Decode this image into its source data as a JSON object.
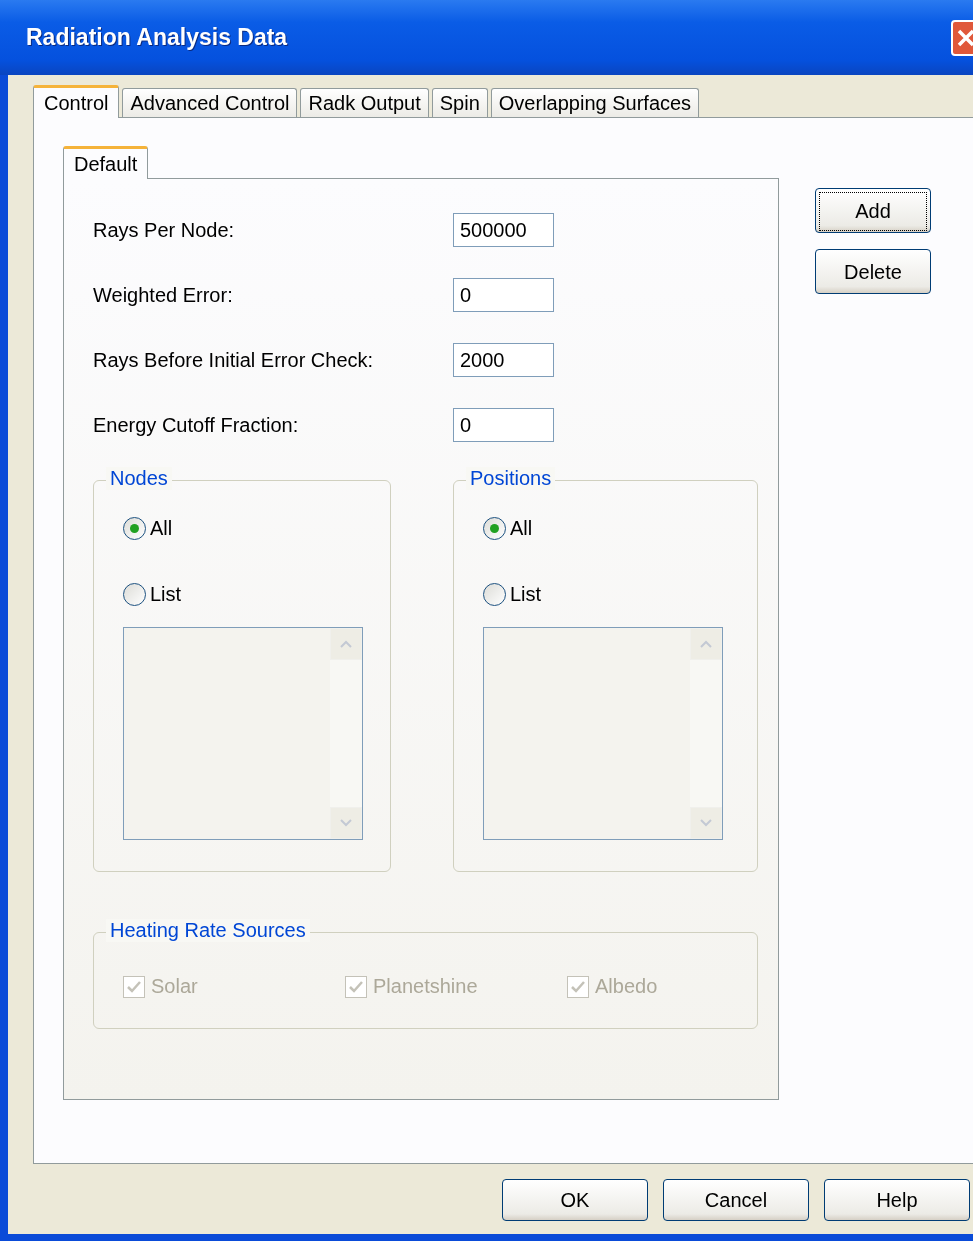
{
  "window": {
    "title": "Radiation Analysis Data"
  },
  "tabs": [
    {
      "label": "Control",
      "selected": true
    },
    {
      "label": "Advanced Control",
      "selected": false
    },
    {
      "label": "Radk Output",
      "selected": false
    },
    {
      "label": "Spin",
      "selected": false
    },
    {
      "label": "Overlapping Surfaces",
      "selected": false
    }
  ],
  "subtabs": [
    {
      "label": "Default",
      "selected": true
    }
  ],
  "fields": [
    {
      "label": "Rays Per Node:",
      "value": "500000"
    },
    {
      "label": "Weighted Error:",
      "value": "0"
    },
    {
      "label": "Rays Before Initial Error Check:",
      "value": "2000"
    },
    {
      "label": "Energy Cutoff Fraction:",
      "value": "0"
    }
  ],
  "side_buttons": [
    {
      "label": "Add",
      "focused": true
    },
    {
      "label": "Delete",
      "focused": false
    }
  ],
  "groups": [
    {
      "title": "Nodes",
      "options": [
        {
          "label": "All",
          "selected": true
        },
        {
          "label": "List",
          "selected": false
        }
      ]
    },
    {
      "title": "Positions",
      "options": [
        {
          "label": "All",
          "selected": true
        },
        {
          "label": "List",
          "selected": false
        }
      ]
    }
  ],
  "heating": {
    "title": "Heating Rate Sources",
    "disabled": true,
    "items": [
      {
        "label": "Solar",
        "checked": true
      },
      {
        "label": "Planetshine",
        "checked": true
      },
      {
        "label": "Albedo",
        "checked": true
      }
    ]
  },
  "buttons": [
    "OK",
    "Cancel",
    "Help"
  ]
}
